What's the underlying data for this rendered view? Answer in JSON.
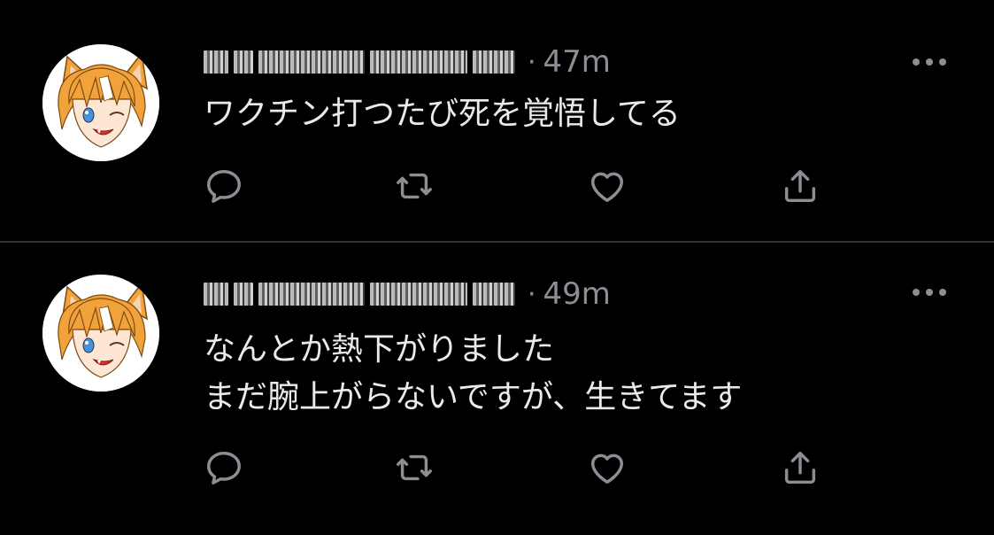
{
  "tweets": [
    {
      "author_name": "",
      "handle": "",
      "separator": "·",
      "time": "47m",
      "text": "ワクチン打つたび死を覚悟してる",
      "avatar_icon": "anime-catboy-avatar",
      "actions": [
        "reply-icon",
        "retweet-icon",
        "like-icon",
        "share-icon"
      ],
      "more_icon": "more-horizontal-icon"
    },
    {
      "author_name": "",
      "handle": "",
      "separator": "·",
      "time": "49m",
      "text": "なんとか熱下がりました\nまだ腕上がらないですが、生きてます",
      "avatar_icon": "anime-catboy-avatar",
      "actions": [
        "reply-icon",
        "retweet-icon",
        "like-icon",
        "share-icon"
      ],
      "more_icon": "more-horizontal-icon"
    }
  ],
  "colors": {
    "background": "#000000",
    "text": "#e8eaed",
    "secondary_text": "#8b8f95",
    "divider": "#2f3336",
    "avatar_hair": "#f2a23a",
    "avatar_mouth": "#e0302a",
    "avatar_eye": "#4a90d9"
  }
}
